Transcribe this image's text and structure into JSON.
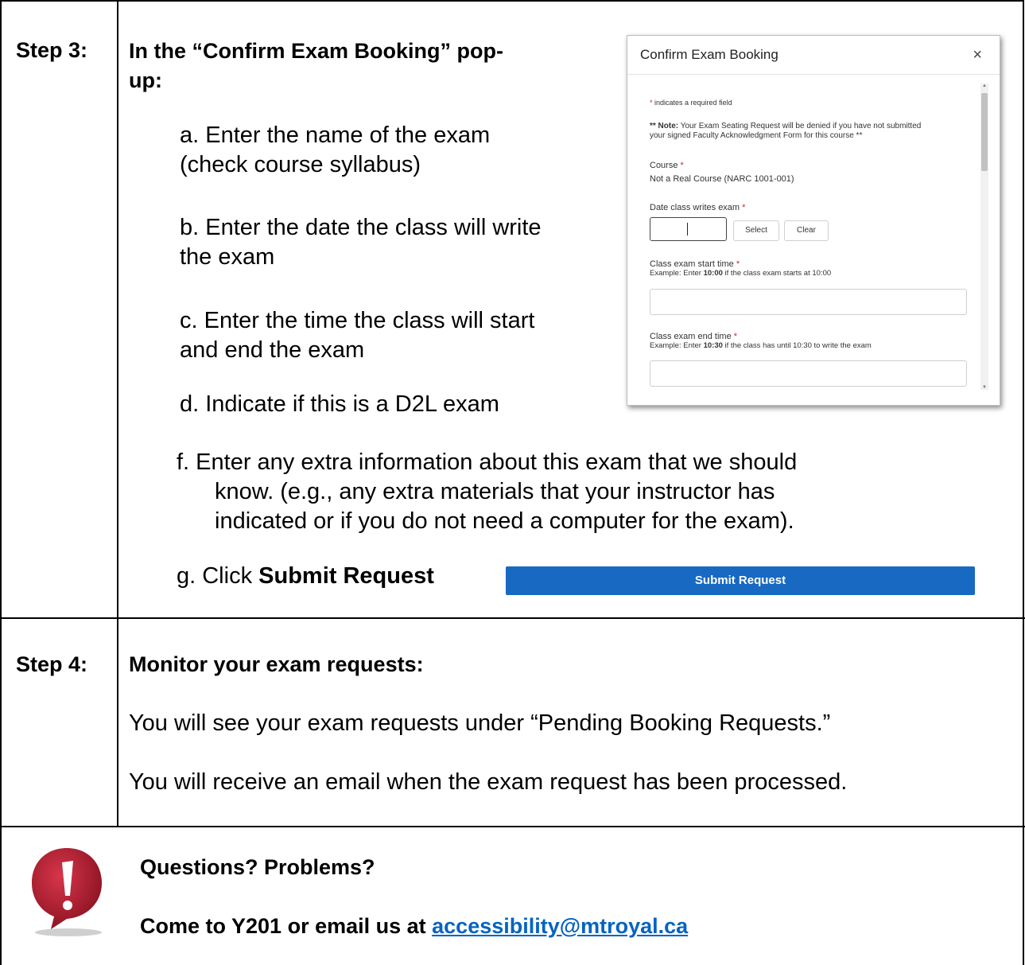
{
  "step3": {
    "label": "Step 3:",
    "heading_line1": "In the “Confirm Exam Booking” pop-",
    "heading_line2": "up:",
    "a_line1": "a.  Enter the name of the exam",
    "a_line2": "(check course syllabus)",
    "b_line1": "b.  Enter the date the class will write",
    "b_line2": "the exam",
    "c_line1": "c.  Enter the time the class will start",
    "c_line2": "and end the exam",
    "d": "d.  Indicate if this is a D2L exam",
    "f_line1": "f.   Enter any extra information about this exam that we should",
    "f_line2": "know. (e.g., any extra materials that your instructor has",
    "f_line3": "indicated or if you do not need a computer for the exam).",
    "g_prefix": "g.  Click ",
    "g_bold": "Submit Request"
  },
  "popup": {
    "title": "Confirm Exam Booking",
    "close_glyph": "×",
    "required_star": "*",
    "required_note": " indicates a required field",
    "note_bold": "** Note:",
    "note_line1": " Your Exam Seating Request will be denied if you have not submitted",
    "note_line2": "your signed Faculty Acknowledgment Form for this course **",
    "course_label": "Course",
    "course_value": "Not a Real Course (NARC 1001-001)",
    "date_label": "Date class writes exam",
    "select_button": "Select",
    "clear_button": "Clear",
    "start_label": "Class exam start time",
    "start_example_prefix": "Example: Enter ",
    "start_example_bold": "10:00",
    "start_example_suffix": " if the class exam starts at 10:00",
    "end_label": "Class exam end time",
    "end_example_prefix": "Example: Enter ",
    "end_example_bold": "10:30",
    "end_example_suffix": " if the class has until 10:30 to write the exam"
  },
  "submit_button": "Submit Request",
  "step4": {
    "label": "Step 4:",
    "heading": "Monitor your exam requests:",
    "para1": "You will see your exam requests under “Pending Booking Requests.”",
    "para2": "You will receive an email when the exam request has been processed."
  },
  "footer": {
    "questions": "Questions? Problems?",
    "contact_prefix": "Come to Y201 or email us at ",
    "email": "accessibility@mtroyal.ca"
  },
  "colors": {
    "button_blue": "#1769c2",
    "required_red": "#c62828",
    "link_blue": "#0563c1",
    "alert_red": "#b01e2e"
  }
}
